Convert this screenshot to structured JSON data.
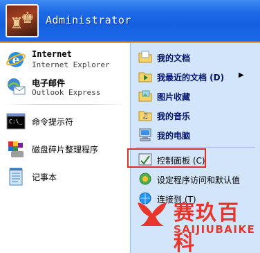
{
  "header": {
    "username": "Administrator"
  },
  "pinned": [
    {
      "title": "Internet",
      "subtitle": "Internet Explorer",
      "icon": "internet-explorer-icon"
    },
    {
      "title": "电子邮件",
      "subtitle": "Outlook Express",
      "icon": "outlook-express-icon"
    }
  ],
  "recent": [
    {
      "label": "命令提示符",
      "icon": "command-prompt-icon"
    },
    {
      "label": "磁盘碎片整理程序",
      "icon": "disk-defragmenter-icon"
    },
    {
      "label": "记事本",
      "icon": "notepad-icon"
    }
  ],
  "places": [
    {
      "label": "我的文档",
      "icon": "my-documents-icon"
    },
    {
      "label": "我最近的文档 (D)",
      "icon": "recent-documents-icon"
    },
    {
      "label": "图片收藏",
      "icon": "my-pictures-icon"
    },
    {
      "label": "我的音乐",
      "icon": "my-music-icon"
    },
    {
      "label": "我的电脑",
      "icon": "my-computer-icon"
    }
  ],
  "system": [
    {
      "label": "控制面板 (C)",
      "icon": "control-panel-icon"
    },
    {
      "label": "设定程序访问和默认值",
      "icon": "set-program-access-icon"
    },
    {
      "label": "连接到 (T)",
      "icon": "connect-to-icon"
    }
  ],
  "watermark": {
    "chinese": "赛玖百科",
    "english": "SAIJIUBAIKE"
  },
  "colors": {
    "header_blue": "#1560de",
    "right_pane": "#d3e5fa",
    "highlight_red": "#d9302c",
    "watermark_red": "#e8362c"
  }
}
